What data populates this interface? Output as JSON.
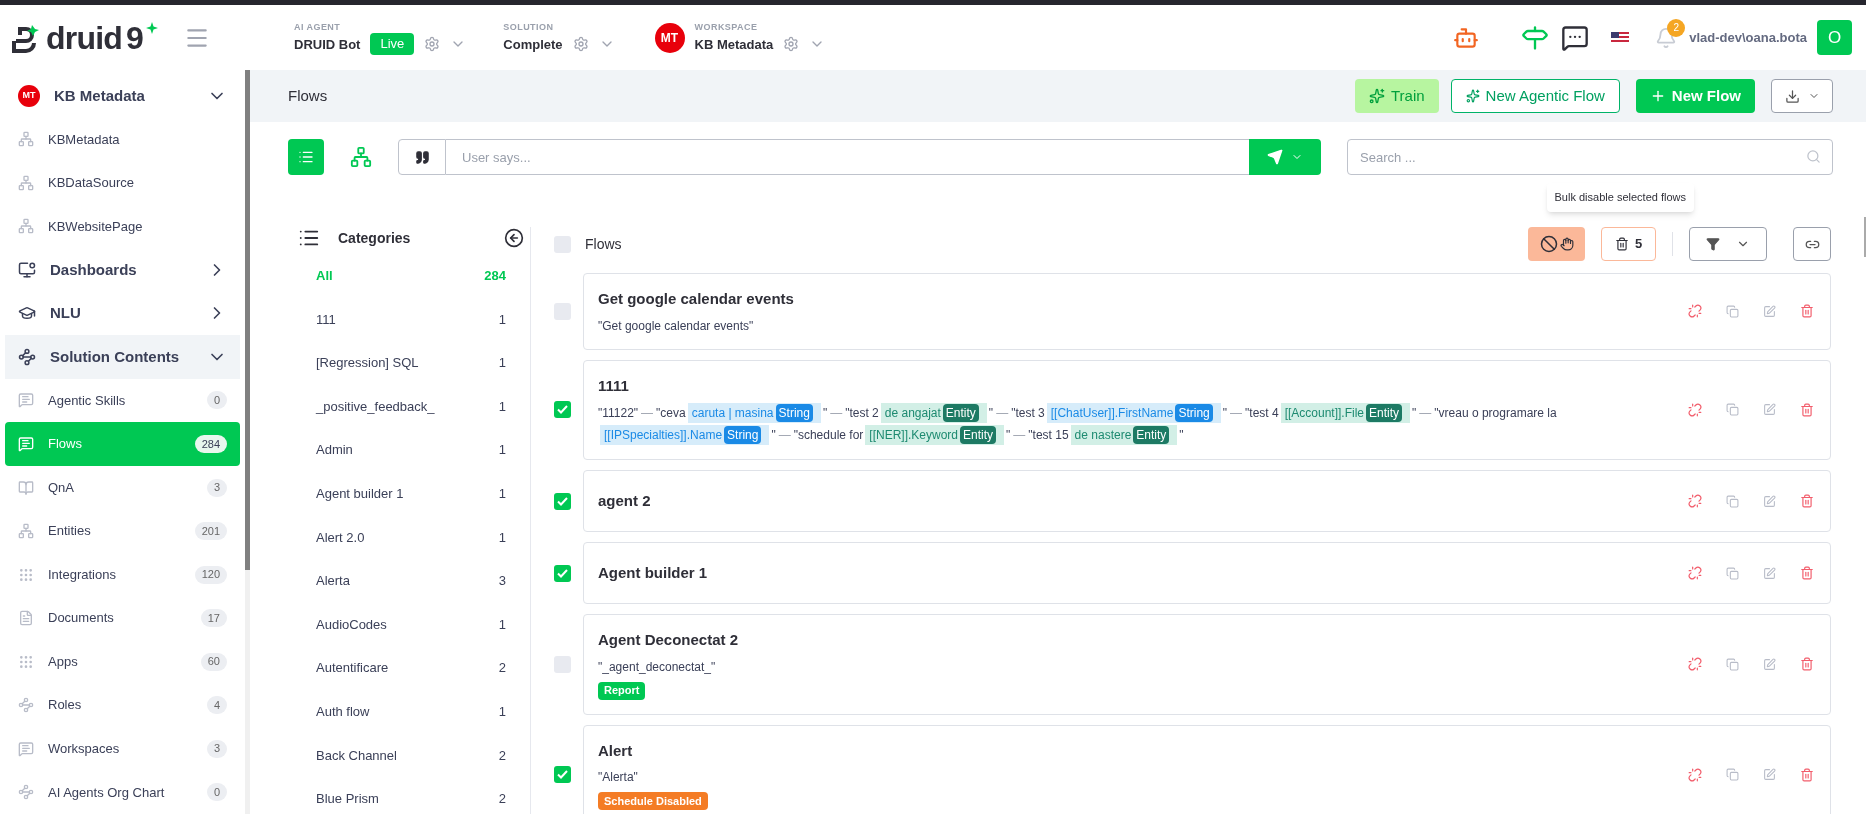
{
  "header": {
    "logo": {
      "word": "druid",
      "mark": "9"
    },
    "agent": {
      "label": "AI AGENT",
      "value": "DRUID Bot",
      "status": "Live"
    },
    "solution": {
      "label": "SOLUTION",
      "value": "Complete"
    },
    "workspace": {
      "avatar": "MT",
      "label": "WORKSPACE",
      "value": "KB Metadata"
    },
    "notifications": "2",
    "user": "vlad-dev\\oana.bota",
    "user_avatar": "O"
  },
  "sidebar": [
    {
      "kind": "section",
      "avatar": "MT",
      "label": "KB Metadata",
      "expanded": true,
      "highlighted": false
    },
    {
      "kind": "item",
      "label": "KBMetadata",
      "selected": false
    },
    {
      "kind": "item",
      "label": "KBDataSource",
      "selected": false
    },
    {
      "kind": "item",
      "label": "KBWebsitePage",
      "selected": false
    },
    {
      "kind": "section",
      "label": "Dashboards",
      "expanded": false,
      "highlighted": false
    },
    {
      "kind": "section",
      "label": "NLU",
      "expanded": false,
      "highlighted": false
    },
    {
      "kind": "section",
      "label": "Solution Contents",
      "expanded": true,
      "highlighted": true
    },
    {
      "kind": "item",
      "label": "Agentic Skills",
      "count": "0",
      "selected": false
    },
    {
      "kind": "item",
      "label": "Flows",
      "count": "284",
      "selected": true
    },
    {
      "kind": "item",
      "label": "QnA",
      "count": "3",
      "selected": false
    },
    {
      "kind": "item",
      "label": "Entities",
      "count": "201",
      "selected": false
    },
    {
      "kind": "item",
      "label": "Integrations",
      "count": "120",
      "selected": false
    },
    {
      "kind": "item",
      "label": "Documents",
      "count": "17",
      "selected": false
    },
    {
      "kind": "item",
      "label": "Apps",
      "count": "60",
      "selected": false
    },
    {
      "kind": "item",
      "label": "Roles",
      "count": "4",
      "selected": false
    },
    {
      "kind": "item",
      "label": "Workspaces",
      "count": "3",
      "selected": false
    },
    {
      "kind": "item",
      "label": "AI Agents Org Chart",
      "count": "0",
      "selected": false
    }
  ],
  "page": {
    "title": "Flows",
    "buttons": {
      "train": "Train",
      "agentic": "New Agentic Flow",
      "new_flow": "New Flow"
    },
    "utterance": {
      "placeholder": "User says..."
    },
    "search": {
      "placeholder": "Search ..."
    },
    "tooltip": "Bulk disable selected flows",
    "delete_count": "5"
  },
  "categories": {
    "title": "Categories",
    "items": [
      {
        "label": "All",
        "count": "284",
        "selected": true
      },
      {
        "label": "111",
        "count": "1",
        "selected": false
      },
      {
        "label": "[Regression] SQL",
        "count": "1",
        "selected": false
      },
      {
        "label": "_positive_feedback_",
        "count": "1",
        "selected": false
      },
      {
        "label": "Admin",
        "count": "1",
        "selected": false
      },
      {
        "label": "Agent builder 1",
        "count": "1",
        "selected": false
      },
      {
        "label": "Alert 2.0",
        "count": "1",
        "selected": false
      },
      {
        "label": "Alerta",
        "count": "3",
        "selected": false
      },
      {
        "label": "AudioCodes",
        "count": "1",
        "selected": false
      },
      {
        "label": "Autentificare",
        "count": "2",
        "selected": false
      },
      {
        "label": "Auth flow",
        "count": "1",
        "selected": false
      },
      {
        "label": "Back Channel",
        "count": "2",
        "selected": false
      },
      {
        "label": "Blue Prism",
        "count": "2",
        "selected": false
      }
    ]
  },
  "flows": {
    "title": "Flows",
    "all_checked": false,
    "items": [
      {
        "name": "Get google calendar events",
        "checked": false,
        "parts": [
          {
            "kind": "text",
            "text": "\"Get google calendar events\""
          }
        ]
      },
      {
        "name": "1111",
        "checked": true,
        "parts": [
          {
            "kind": "text",
            "text": "\"11122\""
          },
          {
            "kind": "sep",
            "text": "—"
          },
          {
            "kind": "text",
            "text": "\"ceva"
          },
          {
            "kind": "string",
            "text": "caruta | masina",
            "type": "String"
          },
          {
            "kind": "text",
            "text": "\""
          },
          {
            "kind": "sep",
            "text": "—"
          },
          {
            "kind": "text",
            "text": "\"test 2"
          },
          {
            "kind": "entity",
            "text": "de angajat",
            "type": "Entity"
          },
          {
            "kind": "text",
            "text": "\""
          },
          {
            "kind": "sep",
            "text": "—"
          },
          {
            "kind": "text",
            "text": "\"test 3"
          },
          {
            "kind": "string",
            "text": "[[ChatUser]].FirstName",
            "type": "String"
          },
          {
            "kind": "text",
            "text": "\""
          },
          {
            "kind": "sep",
            "text": "—"
          },
          {
            "kind": "text",
            "text": "\"test 4"
          },
          {
            "kind": "entity",
            "text": "[[Account]].File",
            "type": "Entity"
          },
          {
            "kind": "text",
            "text": "\""
          },
          {
            "kind": "sep",
            "text": "—"
          },
          {
            "kind": "text",
            "text": "\"vreau o programare la"
          },
          {
            "kind": "string",
            "text": "[[IPSpecialties]].Name",
            "type": "String"
          },
          {
            "kind": "text",
            "text": "\""
          },
          {
            "kind": "sep",
            "text": "—"
          },
          {
            "kind": "text",
            "text": "\"schedule for"
          },
          {
            "kind": "entity",
            "text": "[[NER]].Keyword",
            "type": "Entity"
          },
          {
            "kind": "text",
            "text": "\""
          },
          {
            "kind": "sep",
            "text": "—"
          },
          {
            "kind": "text",
            "text": "\"test 15"
          },
          {
            "kind": "entity",
            "text": "de nastere",
            "type": "Entity"
          },
          {
            "kind": "text",
            "text": "\""
          }
        ]
      },
      {
        "name": "agent 2",
        "checked": true
      },
      {
        "name": "Agent builder 1",
        "checked": true
      },
      {
        "name": "Agent Deconectat 2",
        "checked": false,
        "parts": [
          {
            "kind": "text",
            "text": "\"_agent_deconectat_\""
          }
        ],
        "tags": [
          {
            "label": "Report",
            "color": "#00c853"
          }
        ]
      },
      {
        "name": "Alert",
        "checked": true,
        "parts": [
          {
            "kind": "text",
            "text": "\"Alerta\""
          }
        ],
        "tags": [
          {
            "label": "Schedule Disabled",
            "color": "#f47c25"
          }
        ]
      }
    ]
  }
}
